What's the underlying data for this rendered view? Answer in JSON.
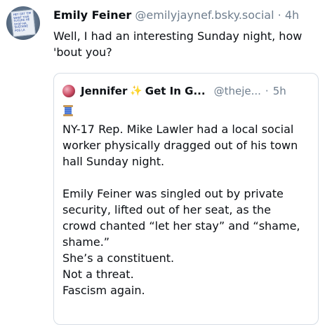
{
  "post": {
    "author": {
      "display_name": "Emily Feiner",
      "handle": "@emilyjaynef.bsky.social",
      "separator": "·",
      "time": "4h",
      "avatar_sign_text": "HEY GET 'EM\nWANT THIS\nFUTURE HE\nSTOP HA\nSUSTAINE\nPOS LA"
    },
    "text": "Well, I had an interesting Sunday night, how 'bout you?"
  },
  "quote": {
    "author": {
      "display_name": "Jennifer",
      "sparkle_icon": "✨",
      "display_name_suffix": "Get In G...",
      "handle": "@theje...",
      "separator": "·",
      "time": "5h"
    },
    "emoji": "spool-of-thread-icon",
    "text": "NY-17 Rep. Mike Lawler had a local social worker physically dragged out of his  town hall Sunday night.\n\nEmily Feiner was singled out by private security, lifted out of her seat, as the crowd chanted “let her stay” and “shame, shame.”\nShe’s a constituent.\nNot a threat.\nFascism again."
  },
  "colors": {
    "text": "#0b0f14",
    "muted": "#6f7e8e",
    "border": "#d6dde5",
    "sparkle": "#f2b72a"
  }
}
